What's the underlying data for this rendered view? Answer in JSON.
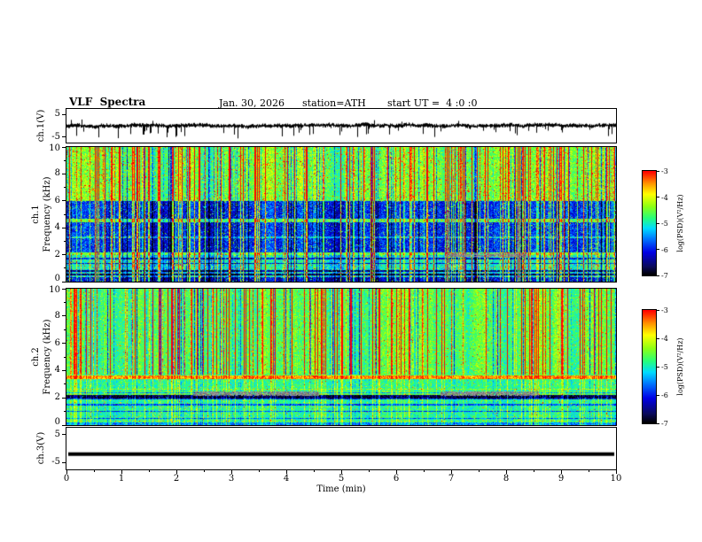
{
  "header": {
    "title": "VLF  Spectra",
    "date": "Jan. 30, 2026",
    "station": "station=ATH",
    "start_ut": "start UT =  4 :0 :0"
  },
  "x_axis": {
    "label": "Time (min)",
    "ticks": [
      "0",
      "1",
      "2",
      "3",
      "4",
      "5",
      "6",
      "7",
      "8",
      "9",
      "10"
    ],
    "range": [
      0,
      10
    ]
  },
  "panels": {
    "ch1_wave": {
      "ylabel": "ch.1(V)",
      "yticks": [
        {
          "label": "5",
          "v": 5
        },
        {
          "label": "-5",
          "v": -5
        }
      ]
    },
    "ch1_spec": {
      "channel": "ch.1",
      "ylabel": "Frequency (kHz)",
      "yticks": [
        {
          "label": "10",
          "f": 10
        },
        {
          "label": "8",
          "f": 8
        },
        {
          "label": "6",
          "f": 6
        },
        {
          "label": "4",
          "f": 4
        },
        {
          "label": "2",
          "f": 2
        },
        {
          "label": "0",
          "f": 0
        }
      ]
    },
    "ch2_spec": {
      "channel": "ch.2",
      "ylabel": "Frequency (kHz)",
      "yticks": [
        {
          "label": "10",
          "f": 10
        },
        {
          "label": "8",
          "f": 8
        },
        {
          "label": "6",
          "f": 6
        },
        {
          "label": "4",
          "f": 4
        },
        {
          "label": "2",
          "f": 2
        },
        {
          "label": "0",
          "f": 0
        }
      ]
    },
    "ch3_wave": {
      "ylabel": "ch.3(V)",
      "yticks": [
        {
          "label": "5",
          "v": 5
        },
        {
          "label": "-5",
          "v": -5
        }
      ]
    }
  },
  "colorbar": {
    "label": "log(PSD)(V²/Hz)",
    "ticks": [
      "-3",
      "-4",
      "-5",
      "-6",
      "-7"
    ],
    "range": [
      -3,
      -7
    ]
  },
  "render": {
    "seed": 20260130,
    "vmin": -7,
    "vmax": -3,
    "colormap_stops": [
      [
        0,
        0,
        0,
        0
      ],
      [
        0.08,
        10,
        10,
        90
      ],
      [
        0.22,
        0,
        0,
        230
      ],
      [
        0.35,
        0,
        120,
        255
      ],
      [
        0.45,
        0,
        220,
        255
      ],
      [
        0.55,
        40,
        255,
        120
      ],
      [
        0.66,
        140,
        255,
        20
      ],
      [
        0.78,
        255,
        255,
        0
      ],
      [
        0.88,
        255,
        150,
        0
      ],
      [
        1,
        255,
        0,
        0
      ]
    ]
  },
  "chart_data": [
    {
      "id": "ch1_wave",
      "type": "line",
      "title": "ch.1 voltage waveform",
      "ylabel": "ch.1(V)",
      "xlim": [
        0,
        10
      ],
      "ylim": [
        -5,
        5
      ],
      "description": "Broadband noisy trace centred near 0 V (band about ±1 V) with dense impulsive spikes, mostly downward reaching -4 to -5 V, occasional upward spikes to +3/+4 V, continuous over the full 10 minutes.",
      "noise_amp": 0.8,
      "spike_down_rate": 0.08,
      "spike_up_rate": 0.02
    },
    {
      "id": "ch1_spec",
      "type": "heatmap",
      "title": "ch.1 spectrogram",
      "xlabel": "Time (min)",
      "ylabel": "Frequency (kHz)",
      "zlabel": "log(PSD)(V²/Hz)",
      "xlim": [
        0,
        10
      ],
      "ylim": [
        0,
        10
      ],
      "zlim": [
        -7,
        -3
      ],
      "description": "0–10 kHz vs 0–10 min: yellow-green background above ~6 kHz peppered with red speckles and many full-height impulsive vertical streaks (yellow/orange/red); broad blue low-power band between ~2 and 6 kHz; bright cyan-green horizontal lines near 2.0 and 4.6 kHz; dark/black narrow horizontal bands below ~1 kHz; faint gray fuzzy patch near 2 kHz around 7–8.4 min.",
      "base_default": -4.45,
      "base_bands": [
        {
          "f": [
            0,
            0.35
          ],
          "v": -6.2
        },
        {
          "f": [
            0.35,
            0.9
          ],
          "v": -5.2
        },
        {
          "f": [
            0.9,
            2.0
          ],
          "v": -5.0
        },
        {
          "f": [
            2.0,
            6.0
          ],
          "v": -5.9
        },
        {
          "f": [
            6.0,
            10.0
          ],
          "v": -4.45
        }
      ],
      "bright_lines": [
        {
          "f": 2.05,
          "v": -4.5,
          "w": 0.09
        },
        {
          "f": 4.55,
          "v": -4.6,
          "w": 0.11
        },
        {
          "f": 3.3,
          "v": -5.15,
          "w": 0.06
        },
        {
          "f": 0.95,
          "v": -4.9,
          "w": 0.06
        },
        {
          "f": 6.1,
          "v": -4.4,
          "w": 0.07
        }
      ],
      "dark_lines": [
        {
          "f": 0.5,
          "v": -6.7,
          "w": 0.06
        },
        {
          "f": 0.8,
          "v": -6.5,
          "w": 0.05
        },
        {
          "f": 1.35,
          "v": -6.2,
          "w": 0.05
        },
        {
          "f": 1.72,
          "v": -6.1,
          "w": 0.05
        }
      ],
      "gray_patches": [
        {
          "x": [
            6.9,
            8.4
          ],
          "f": [
            1.85,
            2.1
          ]
        }
      ],
      "streak_rate": 0.2,
      "streak_dark_rate": 0.12,
      "noise": 0.9,
      "speckle_rate": 0.04,
      "speckle_boost": 1.4,
      "streak_full_above": 0,
      "streak_low_factor": 1.0
    },
    {
      "id": "ch2_spec",
      "type": "heatmap",
      "title": "ch.2 spectrogram",
      "xlabel": "Time (min)",
      "ylabel": "Frequency (kHz)",
      "zlabel": "log(PSD)(V²/Hz)",
      "xlim": [
        0,
        10
      ],
      "ylim": [
        0,
        10
      ],
      "zlim": [
        -7,
        -3
      ],
      "description": "0–10 kHz vs 0–10 min: mostly green/cyan background; strong red-yellow horizontal band near 3.5 kHz across the whole record; black band near 2.1 kHz with fuzzy gray segments around 2.3–4.6 min and 6.8–8.6 min; thin dark horizontal lines near 0.5, 1.0, 1.5 kHz; impulsive vertical streaks mainly above ~4 kHz.",
      "base_default": -4.65,
      "base_bands": [
        {
          "f": [
            0,
            0.2
          ],
          "v": -5.5
        },
        {
          "f": [
            0.2,
            2.0
          ],
          "v": -4.9
        },
        {
          "f": [
            2.45,
            3.35
          ],
          "v": -4.85
        },
        {
          "f": [
            3.8,
            10.0
          ],
          "v": -4.6
        }
      ],
      "bright_lines": [
        {
          "f": 3.5,
          "v": -3.5,
          "w": 0.13
        },
        {
          "f": 2.62,
          "v": -4.4,
          "w": 0.05
        },
        {
          "f": 0.3,
          "v": -4.55,
          "w": 0.05
        }
      ],
      "dark_lines": [
        {
          "f": 2.1,
          "v": -6.8,
          "w": 0.12
        },
        {
          "f": 1.92,
          "v": -5.9,
          "w": 0.05
        },
        {
          "f": 0.5,
          "v": -5.7,
          "w": 0.05
        },
        {
          "f": 1.0,
          "v": -5.8,
          "w": 0.05
        },
        {
          "f": 1.5,
          "v": -5.8,
          "w": 0.05
        },
        {
          "f": 2.38,
          "v": -5.5,
          "w": 0.04
        }
      ],
      "gray_patches": [
        {
          "x": [
            2.3,
            4.6
          ],
          "f": [
            2.15,
            2.45
          ]
        },
        {
          "x": [
            6.8,
            8.6
          ],
          "f": [
            2.15,
            2.45
          ]
        }
      ],
      "streak_rate": 0.2,
      "streak_dark_rate": 0.1,
      "noise": 0.8,
      "speckle_rate": 0.025,
      "speckle_boost": 1.2,
      "streak_full_above": 3.7,
      "streak_low_factor": 0.35
    },
    {
      "id": "ch3_wave",
      "type": "line",
      "title": "ch.3 voltage waveform",
      "ylabel": "ch.3(V)",
      "xlim": [
        0,
        10
      ],
      "ylim": [
        -5,
        5
      ],
      "description": "Completely flat thick black trace at a constant level of about -2 V for the whole record (dead/disconnected channel).",
      "constant_value": -2,
      "line_width": 4
    }
  ]
}
